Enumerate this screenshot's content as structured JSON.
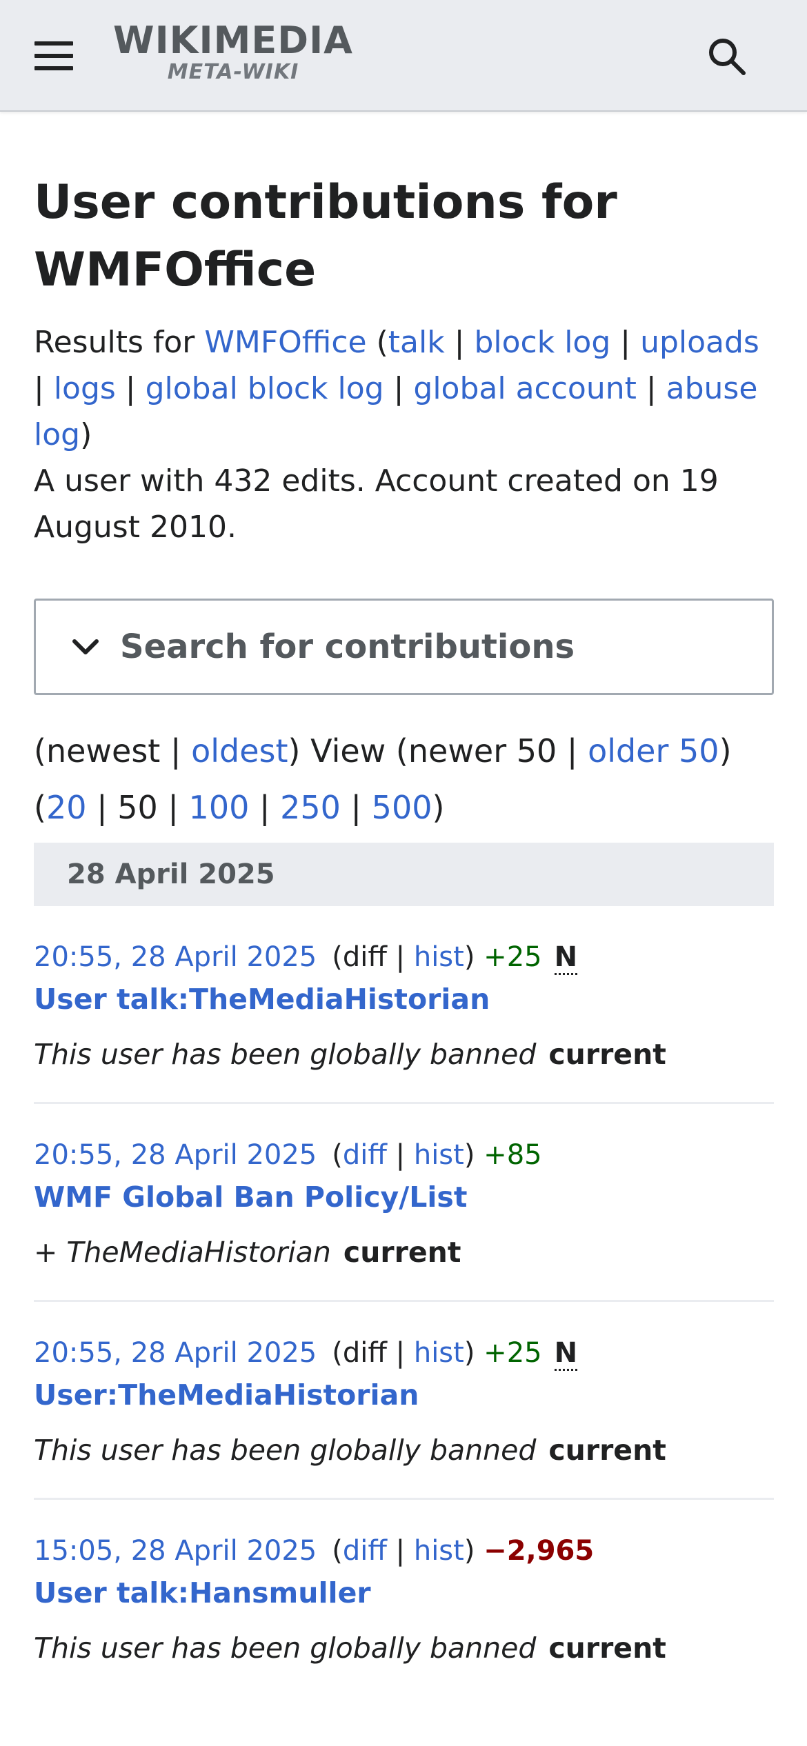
{
  "header": {
    "logo_main": "WIKIMEDIA",
    "logo_sub": "META-WIKI",
    "menu_icon": "hamburger-menu-icon",
    "search_icon": "search-icon"
  },
  "page": {
    "title": "User contributions for WMFOffice",
    "results_for": "Results for",
    "username": "WMFOffice",
    "links": [
      "talk",
      "block log",
      "uploads",
      "logs",
      "global block log",
      "global account",
      "abuse log"
    ],
    "user_info": "A user with 432 edits. Account created on 19 August 2010."
  },
  "search_contrib": {
    "label": "Search for contributions"
  },
  "nav": {
    "newest": "newest",
    "oldest": "oldest",
    "view": "View",
    "newer": "newer 50",
    "older": "older 50",
    "limits": [
      "20",
      "50",
      "100",
      "250",
      "500"
    ]
  },
  "date_header": "28 April 2025",
  "colors": {
    "link": "#3366cc",
    "positive": "#006400",
    "negative": "#8b0000"
  },
  "entries": [
    {
      "timestamp": "20:55, 28 April 2025",
      "diff": "diff",
      "hist": "hist",
      "size": "+25",
      "new_flag": "N",
      "title": "User talk:TheMediaHistorian",
      "summary": "This user has been globally banned",
      "current": "current"
    },
    {
      "timestamp": "20:55, 28 April 2025",
      "diff": "diff",
      "hist": "hist",
      "size": "+85",
      "new_flag": "",
      "title": "WMF Global Ban Policy/List",
      "summary": "+ TheMediaHistorian",
      "current": "current"
    },
    {
      "timestamp": "20:55, 28 April 2025",
      "diff": "diff",
      "hist": "hist",
      "size": "+25",
      "new_flag": "N",
      "title": "User:TheMediaHistorian",
      "summary": "This user has been globally banned",
      "current": "current"
    },
    {
      "timestamp": "15:05, 28 April 2025",
      "diff": "diff",
      "hist": "hist",
      "size": "−2,965",
      "new_flag": "",
      "title": "User talk:Hansmuller",
      "summary": "This user has been globally banned",
      "current": "current"
    }
  ]
}
